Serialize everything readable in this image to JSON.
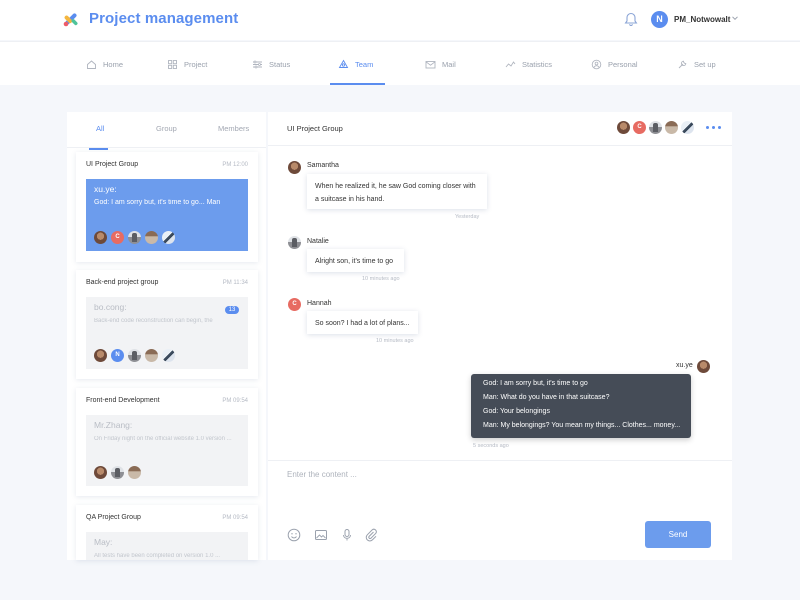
{
  "app": {
    "title": "Project management"
  },
  "user": {
    "initial": "N",
    "name": "PM_Notwowalt"
  },
  "nav": [
    {
      "label": "Home",
      "icon": "home-icon"
    },
    {
      "label": "Project",
      "icon": "grid-icon"
    },
    {
      "label": "Status",
      "icon": "sliders-icon"
    },
    {
      "label": "Team",
      "icon": "team-icon",
      "active": true
    },
    {
      "label": "Mail",
      "icon": "mail-icon"
    },
    {
      "label": "Statistics",
      "icon": "chart-icon"
    },
    {
      "label": "Personal",
      "icon": "person-icon"
    },
    {
      "label": "Set up",
      "icon": "wrench-icon"
    }
  ],
  "tabs": [
    "All",
    "Group",
    "Members"
  ],
  "groups": [
    {
      "name": "UI Project Group",
      "time": "PM 12:00",
      "sender": "xu.ye:",
      "message": "God: I am sorry but, it's time to go... Man"
    },
    {
      "name": "Back-end project group",
      "time": "PM 11:34",
      "sender": "bo.cong:",
      "message": "Back-end code reconstruction can begin, the ...",
      "badge": "13",
      "avatar_initial": "N"
    },
    {
      "name": "Front-end Development",
      "time": "PM 09:54",
      "sender": "Mr.Zhang:",
      "message": "On Friday night on the official website 1.0 version ..."
    },
    {
      "name": "QA Project Group",
      "time": "PM 09:54",
      "sender": "May:",
      "message": "All tests have been completed on version 1.0 ..."
    }
  ],
  "chat": {
    "title": "UI Project Group",
    "header_avatar_initial": "C",
    "messages": [
      {
        "sender": "Samantha",
        "avatar_initial": "",
        "text": "When he realized it, he saw God coming closer with a suitcase in his hand.",
        "time": "Yesterday"
      },
      {
        "sender": "Natalie",
        "text": "Alright son, it's time to go",
        "time": "10 minutes ago"
      },
      {
        "sender": "Hannah",
        "avatar_initial": "C",
        "text": "So soon? I had a lot of plans...",
        "time": "10 minutes ago"
      }
    ],
    "own": {
      "sender": "xu.ye",
      "lines": [
        "God: I am sorry but, it's time to go",
        "Man: What do you have in that suitcase?",
        "God: Your belongings",
        "Man: My belongings? You mean my things... Clothes... money..."
      ],
      "time": "5 seconds ago"
    },
    "composer_placeholder": "Enter the content ...",
    "send_label": "Send"
  }
}
